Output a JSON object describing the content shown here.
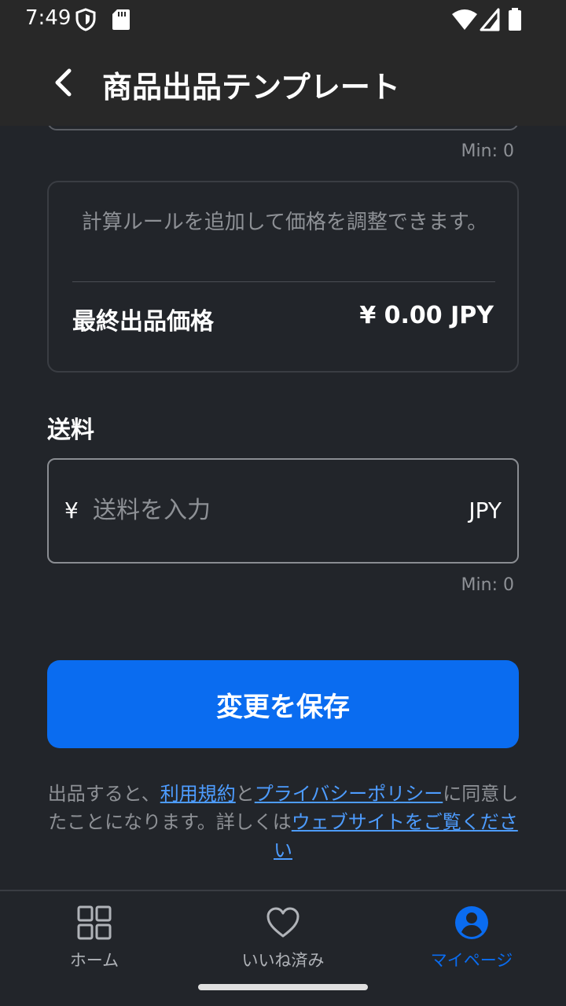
{
  "status": {
    "time": "7:49"
  },
  "header": {
    "title": "商品出品テンプレート"
  },
  "pricing": {
    "min_label_top": "Min: 0",
    "calc_hint": "計算ルールを追加して価格を調整できます。",
    "final_price_label": "最終出品価格",
    "final_price_value": "¥ 0.00 JPY"
  },
  "shipping": {
    "section_title": "送料",
    "currency_symbol": "¥",
    "placeholder": "送料を入力",
    "value": "",
    "currency_code": "JPY",
    "min_label": "Min: 0"
  },
  "actions": {
    "save_label": "変更を保存"
  },
  "legal": {
    "text_1": "出品すると、",
    "terms_link": "利用規約",
    "text_2": "と",
    "privacy_link": "プライバシーポリシー",
    "text_3": "に同意したことになります。詳しくは",
    "website_link": "ウェブサイトをご覧ください"
  },
  "nav": {
    "items": [
      {
        "label": "ホーム",
        "icon": "grid-icon",
        "active": false
      },
      {
        "label": "いいね済み",
        "icon": "heart-icon",
        "active": false
      },
      {
        "label": "マイページ",
        "icon": "user-icon",
        "active": true
      }
    ]
  },
  "colors": {
    "background": "#22252a",
    "appbar": "#282828",
    "accent": "#0a6cf0",
    "link": "#4d9cff",
    "muted_text": "#8e9196"
  }
}
